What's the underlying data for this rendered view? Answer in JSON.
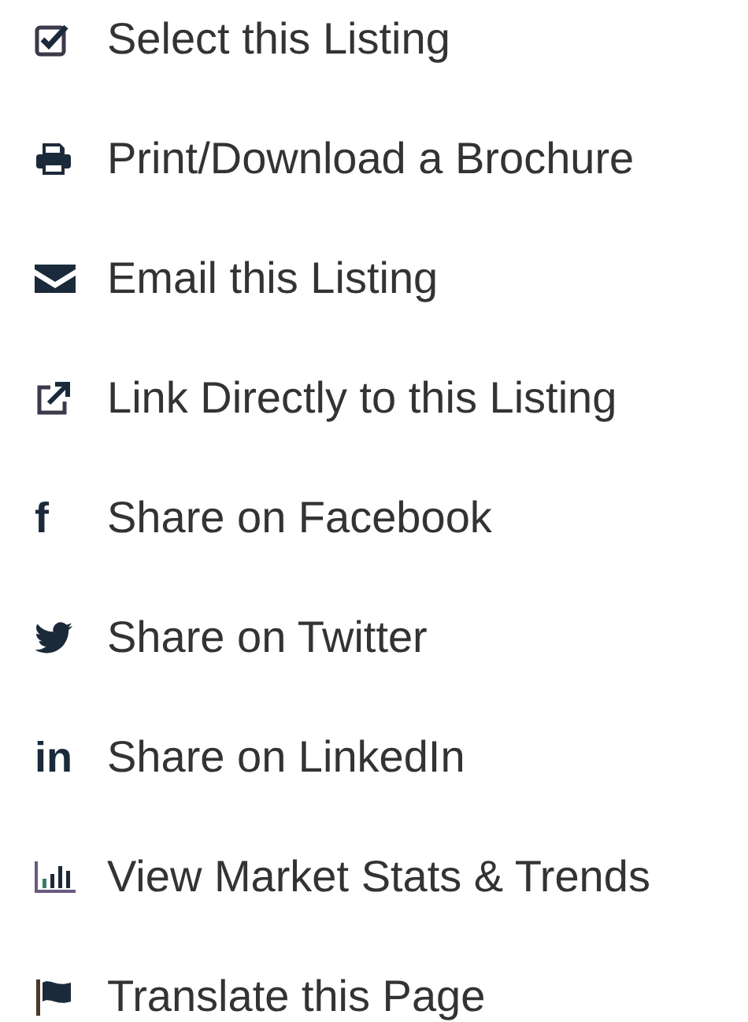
{
  "actions": [
    {
      "kind": "checkbox",
      "label": "Select this Listing"
    },
    {
      "kind": "print",
      "label": "Print/Download a Brochure"
    },
    {
      "kind": "email",
      "label": "Email this Listing"
    },
    {
      "kind": "link",
      "label": "Link Directly to this Listing"
    },
    {
      "kind": "facebook",
      "glyph": "f",
      "label": "Share on Facebook"
    },
    {
      "kind": "twitter",
      "label": "Share on Twitter"
    },
    {
      "kind": "linkedin",
      "glyph": "in",
      "label": "Share on LinkedIn"
    },
    {
      "kind": "stats",
      "label": "View Market Stats & Trends"
    },
    {
      "kind": "flag",
      "label": "Translate this Page"
    }
  ]
}
